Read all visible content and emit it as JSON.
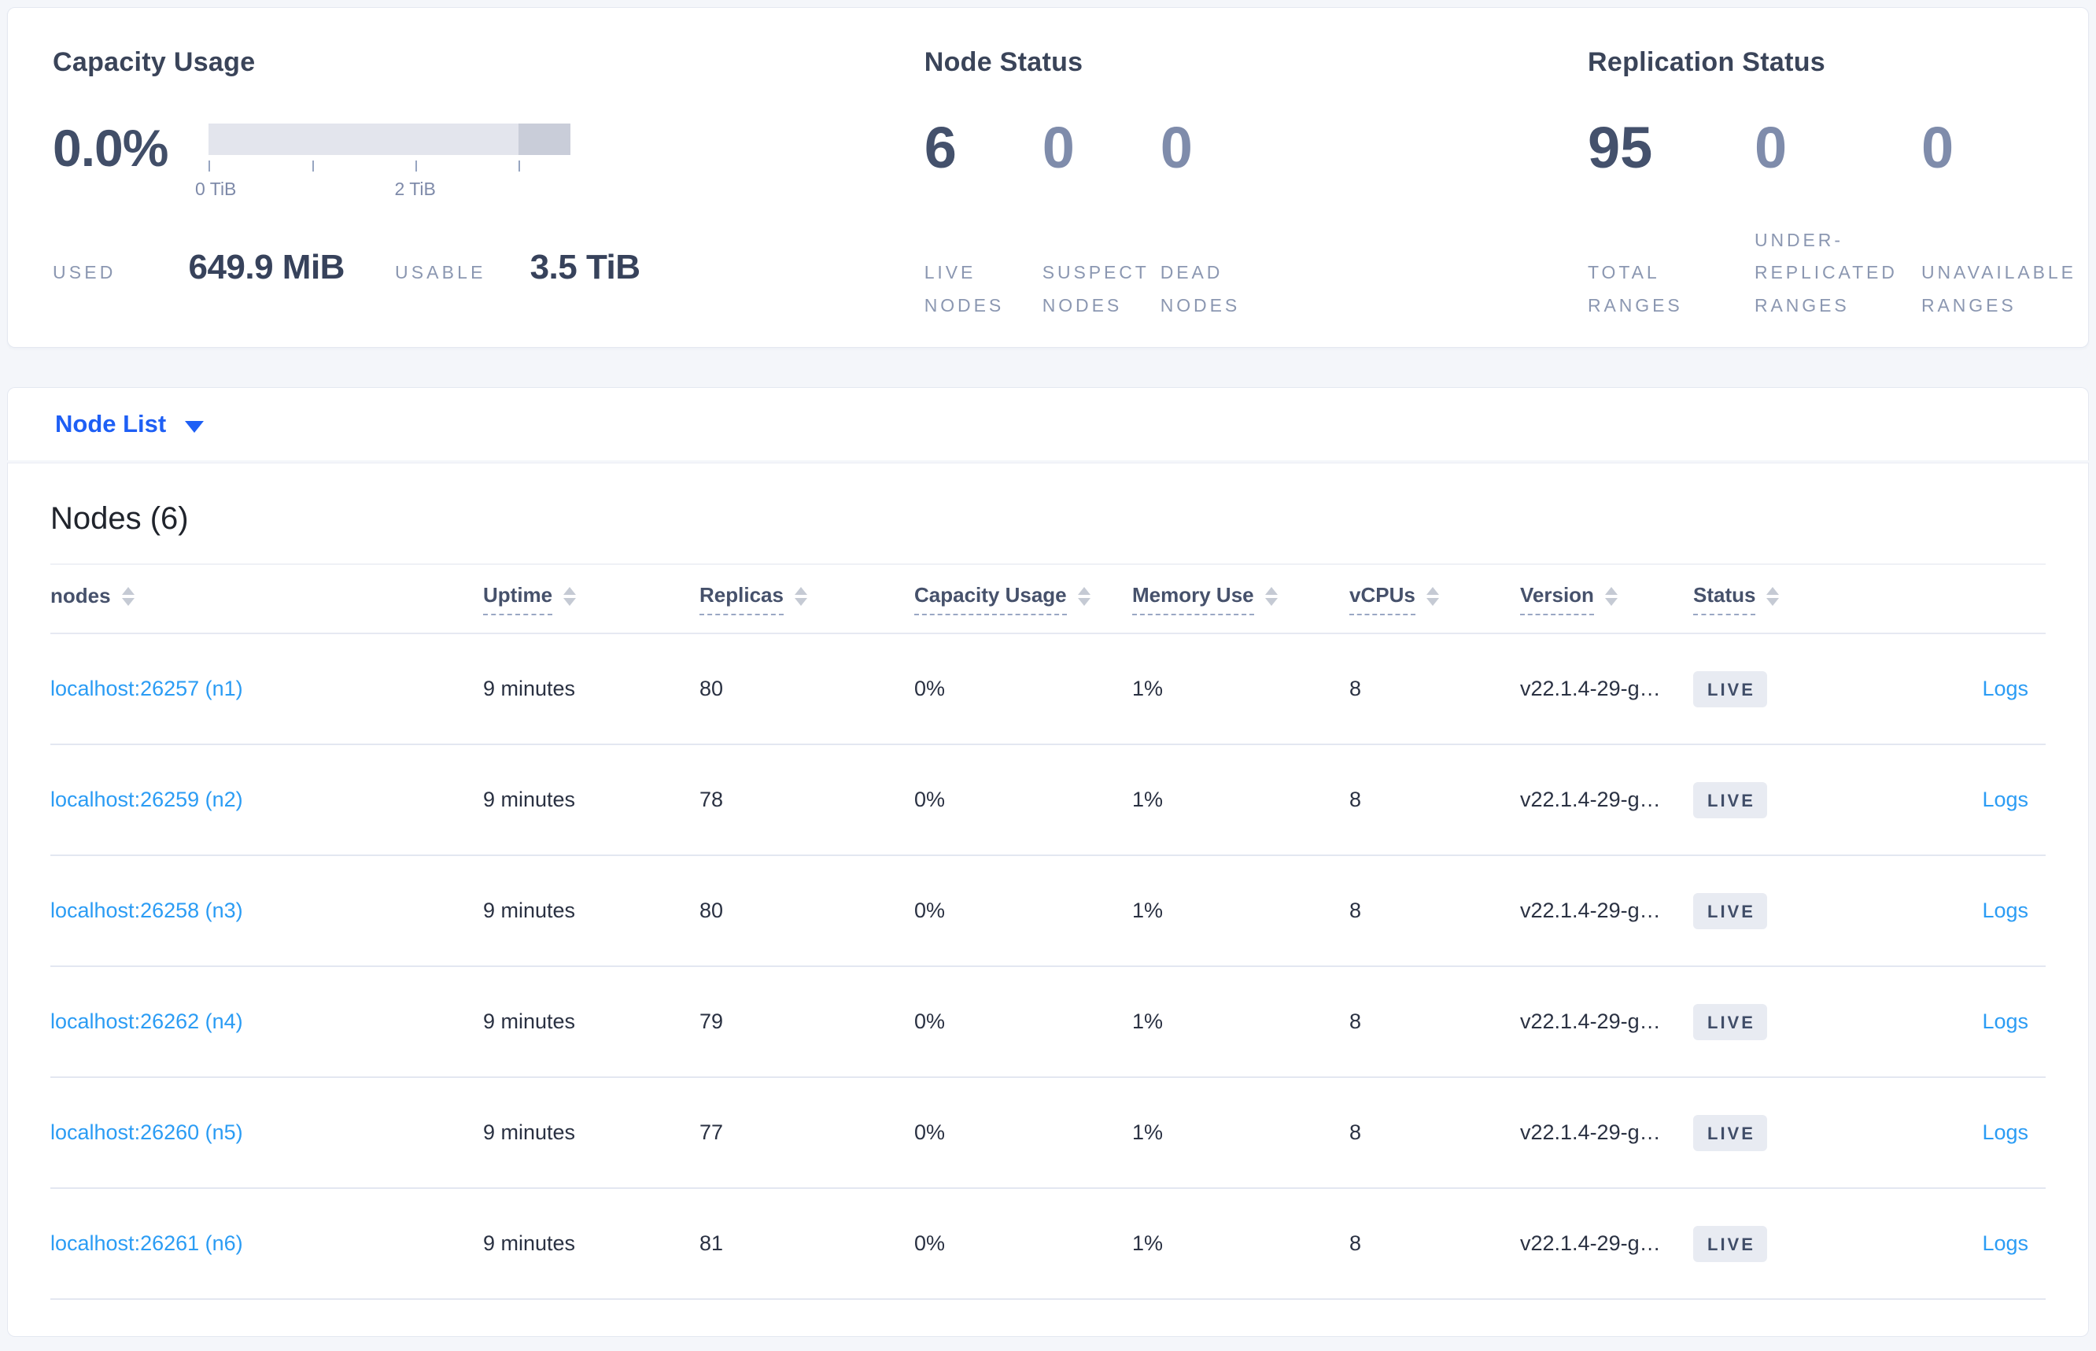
{
  "summary": {
    "capacity": {
      "title": "Capacity Usage",
      "percent": "0.0%",
      "tick_labels": [
        "0 TiB",
        "2 TiB"
      ],
      "used_label": "USED",
      "used_value": "649.9 MiB",
      "usable_label": "USABLE",
      "usable_value": "3.5 TiB"
    },
    "node_status": {
      "title": "Node Status",
      "stats": [
        {
          "value": "6",
          "label": "LIVE NODES"
        },
        {
          "value": "0",
          "label": "SUSPECT NODES"
        },
        {
          "value": "0",
          "label": "DEAD NODES"
        }
      ]
    },
    "replication_status": {
      "title": "Replication Status",
      "stats": [
        {
          "value": "95",
          "label": "TOTAL RANGES"
        },
        {
          "value": "0",
          "label": "UNDER-REPLICATED RANGES"
        },
        {
          "value": "0",
          "label": "UNAVAILABLE RANGES"
        }
      ]
    }
  },
  "view_selector": {
    "label": "Node List"
  },
  "table": {
    "title": "Nodes (6)",
    "columns": {
      "nodes": "nodes",
      "uptime": "Uptime",
      "replicas": "Replicas",
      "capacity": "Capacity Usage",
      "memory": "Memory Use",
      "vcpus": "vCPUs",
      "version": "Version",
      "status": "Status"
    },
    "rows": [
      {
        "node": "localhost:26257 (n1)",
        "uptime": "9 minutes",
        "replicas": "80",
        "capacity": "0%",
        "memory": "1%",
        "vcpus": "8",
        "version": "v22.1.4-29-g…",
        "status": "LIVE",
        "logs": "Logs"
      },
      {
        "node": "localhost:26259 (n2)",
        "uptime": "9 minutes",
        "replicas": "78",
        "capacity": "0%",
        "memory": "1%",
        "vcpus": "8",
        "version": "v22.1.4-29-g…",
        "status": "LIVE",
        "logs": "Logs"
      },
      {
        "node": "localhost:26258 (n3)",
        "uptime": "9 minutes",
        "replicas": "80",
        "capacity": "0%",
        "memory": "1%",
        "vcpus": "8",
        "version": "v22.1.4-29-g…",
        "status": "LIVE",
        "logs": "Logs"
      },
      {
        "node": "localhost:26262 (n4)",
        "uptime": "9 minutes",
        "replicas": "79",
        "capacity": "0%",
        "memory": "1%",
        "vcpus": "8",
        "version": "v22.1.4-29-g…",
        "status": "LIVE",
        "logs": "Logs"
      },
      {
        "node": "localhost:26260 (n5)",
        "uptime": "9 minutes",
        "replicas": "77",
        "capacity": "0%",
        "memory": "1%",
        "vcpus": "8",
        "version": "v22.1.4-29-g…",
        "status": "LIVE",
        "logs": "Logs"
      },
      {
        "node": "localhost:26261 (n6)",
        "uptime": "9 minutes",
        "replicas": "81",
        "capacity": "0%",
        "memory": "1%",
        "vcpus": "8",
        "version": "v22.1.4-29-g…",
        "status": "LIVE",
        "logs": "Logs"
      }
    ]
  },
  "colors": {
    "page_bg": "#f4f6fa",
    "card_bg": "#ffffff",
    "accent_blue": "#1e5ff5",
    "link_blue": "#2b9cf4",
    "bar_track": "#e3e5ed",
    "bar_segment": "#c9cdd9",
    "badge_bg": "#e8ebf2",
    "value_dark": "#44516c",
    "value_muted": "#7f8cab"
  }
}
